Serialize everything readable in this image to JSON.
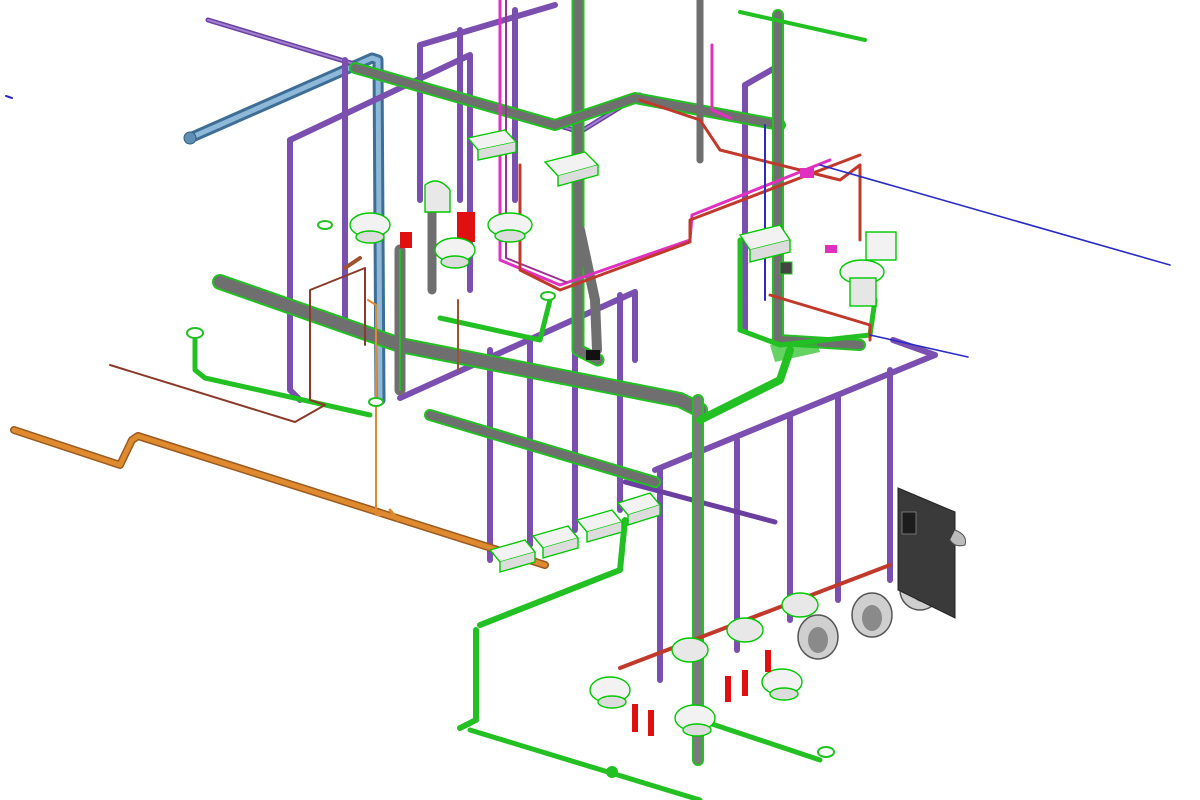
{
  "view": {
    "background": "#ffffff"
  },
  "colors": {
    "sanitary": "#7a7a7a",
    "sanitary_outline": "#22c022",
    "vent": "#7a4fb0",
    "vent_light": "#9b6fd0",
    "storm": "#5f8fb5",
    "hot_water": "#c0392b",
    "cold_water": "#2a2ac8",
    "recirc": "#e030c0",
    "gas": "#e08a30",
    "condensate": "#a0522d",
    "fixture_fill": "#f2f2f2",
    "panel": "#3a3a3a"
  },
  "fixtures": {
    "water_closets": 10,
    "lavatories": 6,
    "floor_drains": 4,
    "urinal_panel": 1
  }
}
